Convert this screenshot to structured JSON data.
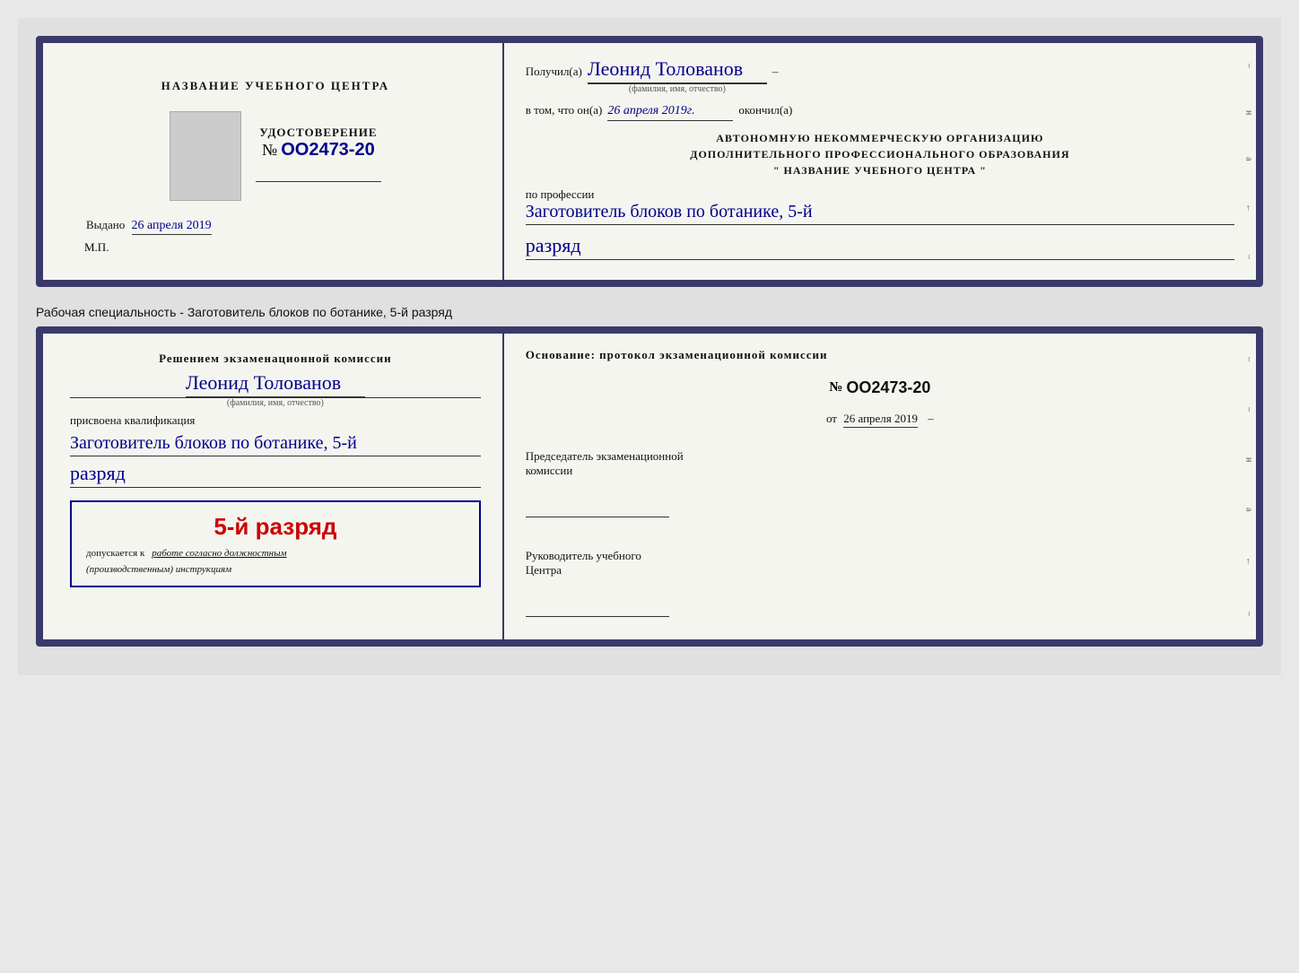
{
  "page": {
    "background_color": "#e0e0e0"
  },
  "top_document": {
    "left": {
      "title": "НАЗВАНИЕ УЧЕБНОГО ЦЕНТРА",
      "udostoverenie_label": "УДОСТОВЕРЕНИЕ",
      "cert_number_prefix": "№",
      "cert_number": "OO2473-20",
      "vydano_label": "Выдано",
      "vydano_date": "26 апреля 2019",
      "mp_label": "М.П."
    },
    "right": {
      "poluchil_label": "Получил(а)",
      "recipient_name": "Леонид Толованов",
      "name_subtitle": "(фамилия, имя, отчество)",
      "dash": "–",
      "vtom_label": "в том, что он(а)",
      "completion_date": "26 апреля 2019г.",
      "okoncil_label": "окончил(а)",
      "org_line1": "АВТОНОМНУЮ НЕКОММЕРЧЕСКУЮ ОРГАНИЗАЦИЮ",
      "org_line2": "ДОПОЛНИТЕЛЬНОГО ПРОФЕССИОНАЛЬНОГО ОБРАЗОВАНИЯ",
      "org_line3": "\"  НАЗВАНИЕ УЧЕБНОГО ЦЕНТРА  \"",
      "po_professii_label": "по профессии",
      "profession_line1": "Заготовитель блоков по ботанике, 5-й",
      "razryad": "разряд"
    }
  },
  "between_text": "Рабочая специальность - Заготовитель блоков по ботанике, 5-й разряд",
  "bottom_document": {
    "left": {
      "resheniem_label": "Решением экзаменационной комиссии",
      "recipient_name": "Леонид Толованов",
      "name_subtitle": "(фамилия, имя, отчество)",
      "prisvoena_label": "присвоена квалификация",
      "profession_line1": "Заготовитель блоков по ботанике, 5-й",
      "razryad": "разряд",
      "stamp_rank": "5-й разряд",
      "stamp_dopuskaetsya": "допускается к",
      "stamp_work_label": "работе согласно должностным",
      "stamp_instruction": "(производственным) инструкциям"
    },
    "right": {
      "osnovanie_label": "Основание: протокол экзаменационной комиссии",
      "protocol_prefix": "№",
      "protocol_number": "OO2473-20",
      "ot_prefix": "от",
      "ot_date": "26 апреля 2019",
      "predsedatel_line1": "Председатель экзаменационной",
      "predsedatel_line2": "комиссии",
      "rukovoditel_line1": "Руководитель учебного",
      "rukovoditel_line2": "Центра"
    }
  },
  "right_edge_labels": [
    "и",
    "а",
    "←",
    "–",
    "–",
    "–",
    "–"
  ]
}
